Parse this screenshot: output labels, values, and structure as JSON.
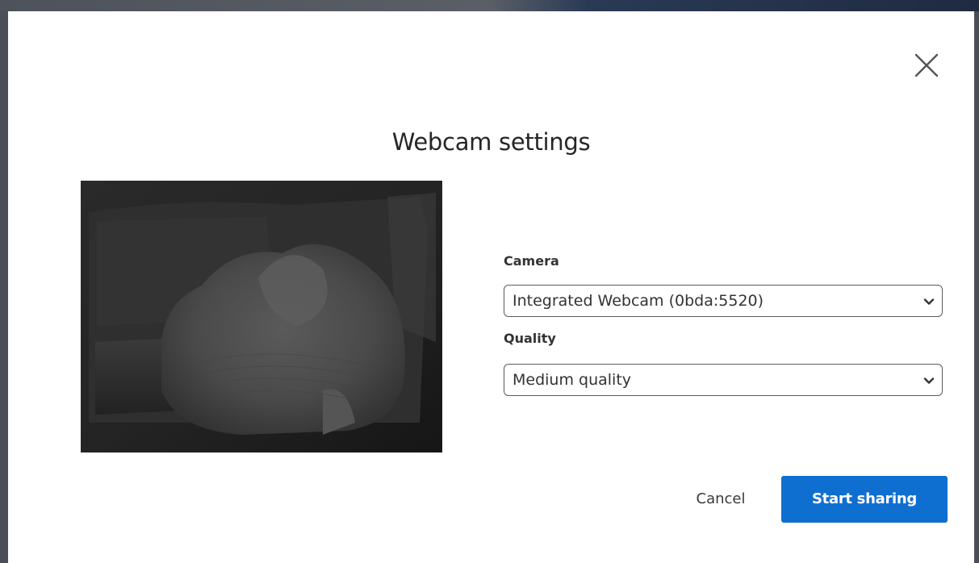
{
  "dialog": {
    "title": "Webcam settings",
    "close_icon": "close-icon"
  },
  "camera": {
    "label": "Camera",
    "selected": "Integrated Webcam (0bda:5520)"
  },
  "quality": {
    "label": "Quality",
    "selected": "Medium quality"
  },
  "actions": {
    "cancel_label": "Cancel",
    "start_label": "Start sharing"
  },
  "colors": {
    "primary": "#0f6fd1",
    "text": "#333333",
    "preview_bg": "#1a1a1a"
  }
}
